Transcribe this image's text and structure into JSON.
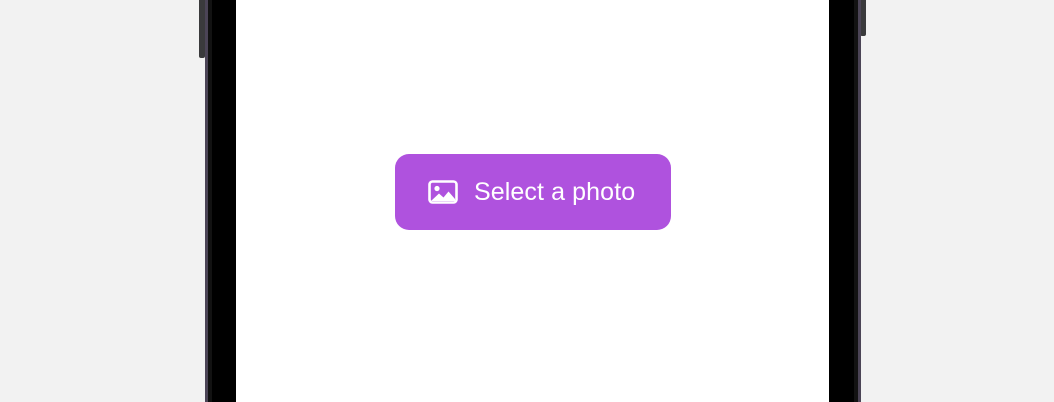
{
  "screen": {
    "select_photo_button": {
      "label": "Select a photo",
      "icon": "photo-icon",
      "background_color": "#af52de",
      "text_color": "#ffffff"
    }
  },
  "colors": {
    "desktop_background": "#f2f2f2",
    "screen_background": "#ffffff",
    "device_bezel": "#000000"
  }
}
